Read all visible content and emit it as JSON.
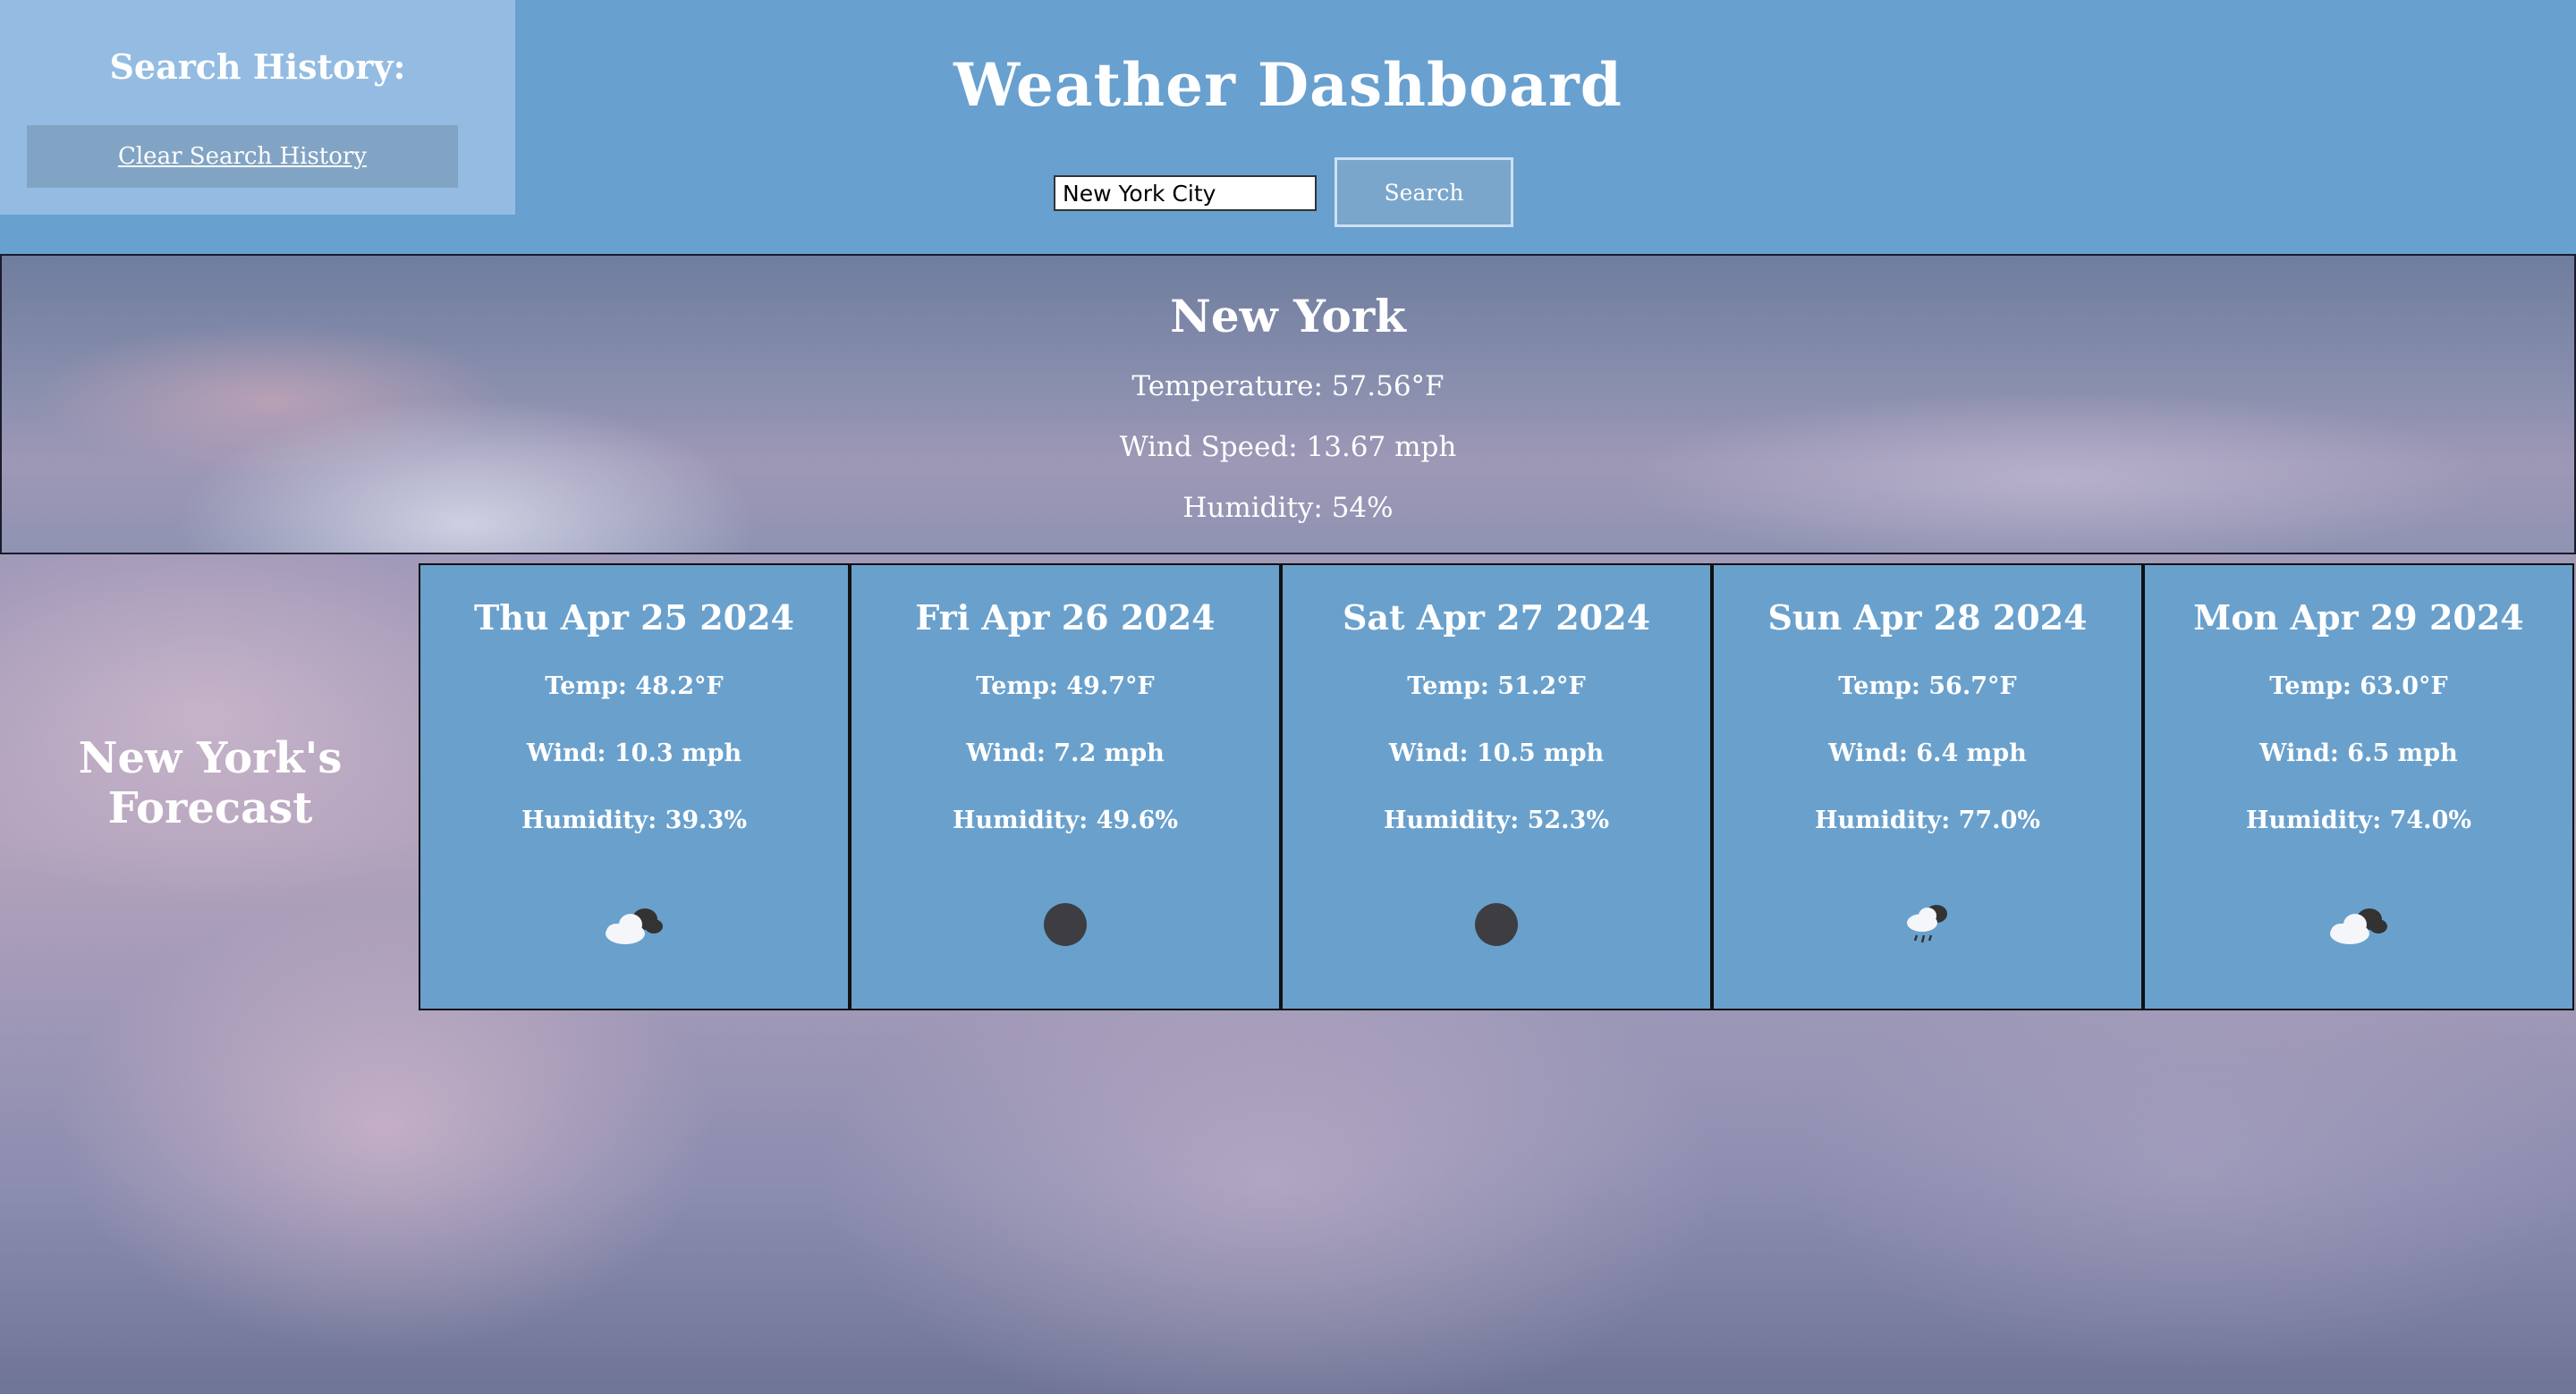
{
  "sidebar": {
    "title": "Search History:",
    "clear_label": "Clear Search History"
  },
  "header": {
    "title": "Weather Dashboard",
    "search_value": "New York City",
    "search_label": "Search"
  },
  "current": {
    "city": "New York",
    "temperature": "Temperature: 57.56°F",
    "wind": "Wind Speed: 13.67 mph",
    "humidity": "Humidity: 54%"
  },
  "forecast": {
    "heading": "New York's Forecast",
    "days": [
      {
        "date": "Thu Apr 25 2024",
        "temp": "Temp: 48.2°F",
        "wind": "Wind: 10.3 mph",
        "humidity": "Humidity: 39.3%",
        "icon": "partly-cloudy-icon"
      },
      {
        "date": "Fri Apr 26 2024",
        "temp": "Temp: 49.7°F",
        "wind": "Wind: 7.2 mph",
        "humidity": "Humidity: 49.6%",
        "icon": "dark-circle-icon"
      },
      {
        "date": "Sat Apr 27 2024",
        "temp": "Temp: 51.2°F",
        "wind": "Wind: 10.5 mph",
        "humidity": "Humidity: 52.3%",
        "icon": "dark-circle-icon"
      },
      {
        "date": "Sun Apr 28 2024",
        "temp": "Temp: 56.7°F",
        "wind": "Wind: 6.4 mph",
        "humidity": "Humidity: 77.0%",
        "icon": "rain-cloud-icon"
      },
      {
        "date": "Mon Apr 29 2024",
        "temp": "Temp: 63.0°F",
        "wind": "Wind: 6.5 mph",
        "humidity": "Humidity: 74.0%",
        "icon": "partly-cloudy-icon"
      }
    ]
  },
  "colors": {
    "header_bg": "#68a0d0",
    "history_bg": "#94bce2",
    "card_bg": "#6aa0cc"
  }
}
